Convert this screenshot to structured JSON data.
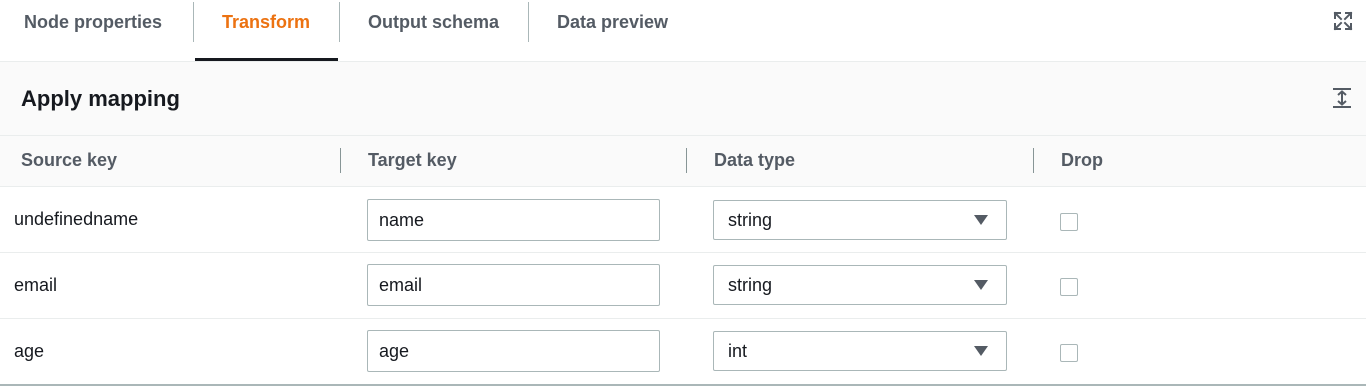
{
  "tabs": {
    "node_properties": "Node properties",
    "transform": "Transform",
    "output_schema": "Output schema",
    "data_preview": "Data preview",
    "active": "Transform"
  },
  "icons": {
    "expand": "expand-arrows-icon",
    "collapse": "collapse-vertical-icon",
    "caret": "caret-down-icon"
  },
  "colors": {
    "active_tab": "#ec7211",
    "text": "#16191f",
    "muted_text": "#545b64",
    "border": "#aab7b8"
  },
  "section": {
    "title": "Apply mapping"
  },
  "columns": {
    "source_key": "Source key",
    "target_key": "Target key",
    "data_type": "Data type",
    "drop": "Drop"
  },
  "rows": [
    {
      "source": "undefinedname",
      "target": "name",
      "type": "string",
      "drop": false
    },
    {
      "source": "email",
      "target": "email",
      "type": "string",
      "drop": false
    },
    {
      "source": "age",
      "target": "age",
      "type": "int",
      "drop": false
    }
  ]
}
